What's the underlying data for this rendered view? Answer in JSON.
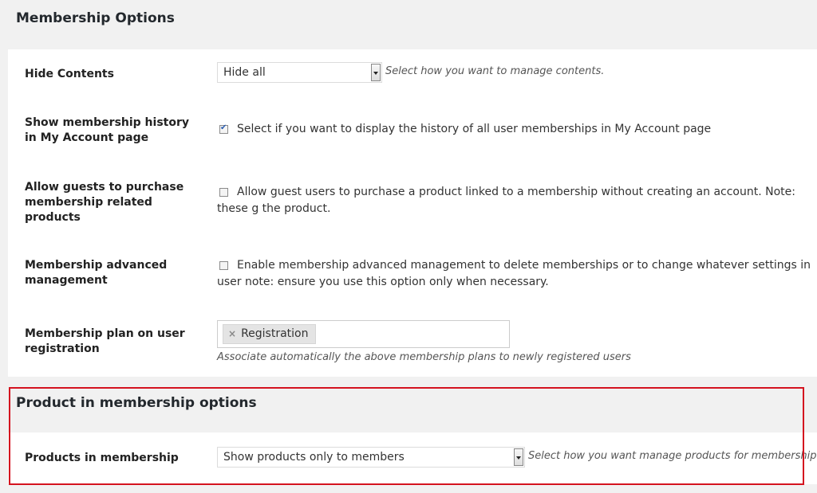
{
  "membership_options": {
    "title": "Membership Options",
    "hide_contents": {
      "label": "Hide Contents",
      "selected": "Hide all",
      "description": "Select how you want to manage contents."
    },
    "show_history": {
      "label": "Show membership history in My Account page",
      "checked": true,
      "text": "Select if you want to display the history of all user memberships in My Account page"
    },
    "allow_guests": {
      "label": "Allow guests to purchase membership related products",
      "checked": false,
      "text": "Allow guest users to purchase a product linked to a membership without creating an account. Note: these g the product."
    },
    "advanced_management": {
      "label": "Membership advanced management",
      "checked": false,
      "text": "Enable membership advanced management to delete memberships or to change whatever settings in user note: ensure you use this option only when necessary."
    },
    "plan_on_registration": {
      "label": "Membership plan on user registration",
      "tag": "Registration",
      "tag_remove_icon": "×",
      "description": "Associate automatically the above membership plans to newly registered users"
    }
  },
  "product_options": {
    "title": "Product in membership options",
    "products_in_membership": {
      "label": "Products in membership",
      "selected": "Show products only to members",
      "description": "Select how you want manage products for membership."
    }
  },
  "icons": {
    "dropdown_arrow": "chevron-down-icon",
    "tag_remove": "close-icon",
    "checkbox_mark": "check-icon"
  },
  "colors": {
    "highlight_border": "#d4131f",
    "background": "#f1f1f1",
    "panel": "#ffffff"
  }
}
